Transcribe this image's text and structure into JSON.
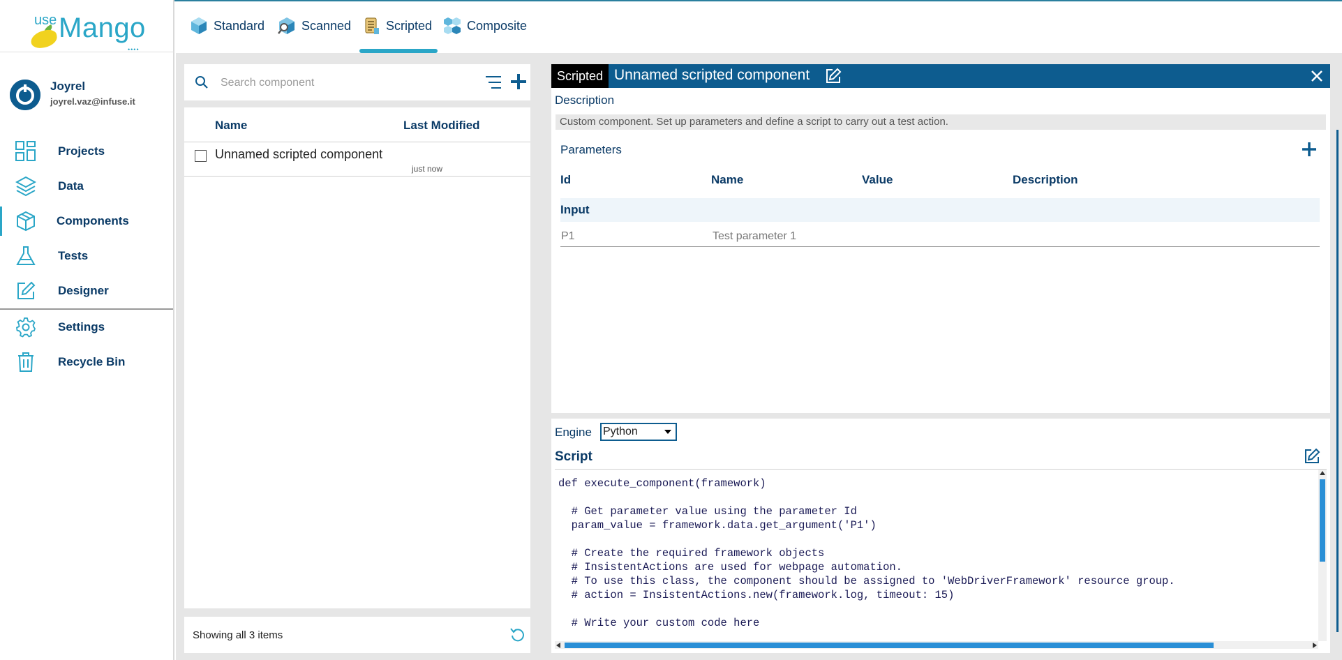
{
  "logo": {
    "use": "use",
    "mango": "Mango",
    "dots": "••••"
  },
  "user": {
    "name": "Joyrel",
    "email": "joyrel.vaz@infuse.it"
  },
  "nav": {
    "items": [
      {
        "label": "Projects",
        "icon": "projects-grid-icon"
      },
      {
        "label": "Data",
        "icon": "layers-icon"
      },
      {
        "label": "Components",
        "icon": "cube-icon",
        "active": true
      },
      {
        "label": "Tests",
        "icon": "flask-icon"
      },
      {
        "label": "Designer",
        "icon": "pencil-square-icon"
      },
      {
        "label": "Settings",
        "icon": "gear-icon"
      },
      {
        "label": "Recycle Bin",
        "icon": "trash-icon"
      }
    ]
  },
  "tabs": [
    {
      "label": "Standard",
      "icon": "standard-cube-icon"
    },
    {
      "label": "Scanned",
      "icon": "scanned-cube-icon"
    },
    {
      "label": "Scripted",
      "icon": "scripted-scroll-icon",
      "active": true
    },
    {
      "label": "Composite",
      "icon": "composite-cubes-icon"
    }
  ],
  "search": {
    "placeholder": "Search component"
  },
  "list": {
    "headers": {
      "name": "Name",
      "modified": "Last Modified"
    },
    "rows": [
      {
        "name": "Unnamed scripted component",
        "modified": "just now"
      }
    ],
    "footer": "Showing all 3 items"
  },
  "detail": {
    "badge": "Scripted",
    "title": "Unnamed scripted component",
    "description_label": "Description",
    "description": "Custom component. Set up parameters and define a script to carry out a test action.",
    "parameters_label": "Parameters",
    "param_headers": {
      "id": "Id",
      "name": "Name",
      "value": "Value",
      "description": "Description"
    },
    "param_group": "Input",
    "params": [
      {
        "id": "P1",
        "name": "Test parameter 1",
        "value": "",
        "description": ""
      }
    ],
    "engine_label": "Engine",
    "engine_value": "Python",
    "script_label": "Script",
    "script": "def execute_component(framework)\n\n  # Get parameter value using the parameter Id\n  param_value = framework.data.get_argument('P1')\n\n  # Create the required framework objects\n  # InsistentActions are used for webpage automation.\n  # To use this class, the component should be assigned to 'WebDriverFramework' resource group.\n  # action = InsistentActions.new(framework.log, timeout: 15)\n\n  # Write your custom code here"
  },
  "colors": {
    "brand": "#2aa6c7",
    "header": "#0d5c8f",
    "text": "#0a3a66"
  }
}
